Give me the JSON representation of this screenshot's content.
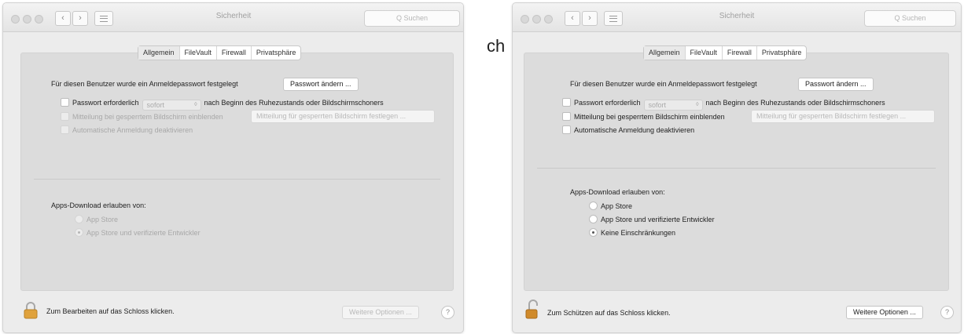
{
  "gap_text": "ch",
  "windows": [
    {
      "title": "Sicherheit",
      "search_placeholder": "Q Suchen",
      "tabs": [
        "Allgemein",
        "FileVault",
        "Firewall",
        "Privatsphäre"
      ],
      "active_tab": "Allgemein",
      "password_set_text": "Für diesen Benutzer wurde ein Anmeldepasswort festgelegt",
      "change_password_button": "Passwort ändern ...",
      "require_password_label": "Passwort erforderlich",
      "require_password_select": "sofort",
      "require_password_suffix": "nach Beginn des Ruhezustands oder Bildschirmschoners",
      "lockscreen_message_label": "Mitteilung bei gesperrtem Bildschirm einblenden",
      "lockscreen_message_button": "Mitteilung für gesperrten Bildschirm festlegen ...",
      "auto_login_label": "Automatische Anmeldung deaktivieren",
      "apps_download_heading": "Apps-Download erlauben von:",
      "radio_options": [
        "App Store",
        "App Store und verifizierte Entwickler"
      ],
      "selected_option": "App Store und verifizierte Entwickler",
      "lock_text": "Zum Bearbeiten auf das Schloss klicken.",
      "more_options_button": "Weitere Optionen ...",
      "help_label": "?"
    },
    {
      "title": "Sicherheit",
      "search_placeholder": "Q Suchen",
      "tabs": [
        "Allgemein",
        "FileVault",
        "Firewall",
        "Privatsphäre"
      ],
      "active_tab": "Allgemein",
      "password_set_text": "Für diesen Benutzer wurde ein Anmeldepasswort festgelegt",
      "change_password_button": "Passwort ändern ...",
      "require_password_label": "Passwort erforderlich",
      "require_password_select": "sofort",
      "require_password_suffix": "nach Beginn des Ruhezustands oder Bildschirmschoners",
      "lockscreen_message_label": "Mitteilung bei gesperrtem Bildschirm einblenden",
      "lockscreen_message_button": "Mitteilung für gesperrten Bildschirm festlegen ...",
      "auto_login_label": "Automatische Anmeldung deaktivieren",
      "apps_download_heading": "Apps-Download erlauben von:",
      "radio_options": [
        "App Store",
        "App Store und verifizierte Entwickler",
        "Keine Einschränkungen"
      ],
      "selected_option": "Keine Einschränkungen",
      "lock_text": "Zum Schützen auf das Schloss klicken.",
      "more_options_button": "Weitere Optionen ...",
      "help_label": "?"
    }
  ],
  "colors": {
    "window_bg": "#ececec",
    "panel_bg": "#dcdcdc",
    "lock_gold": "#e0a23c"
  }
}
